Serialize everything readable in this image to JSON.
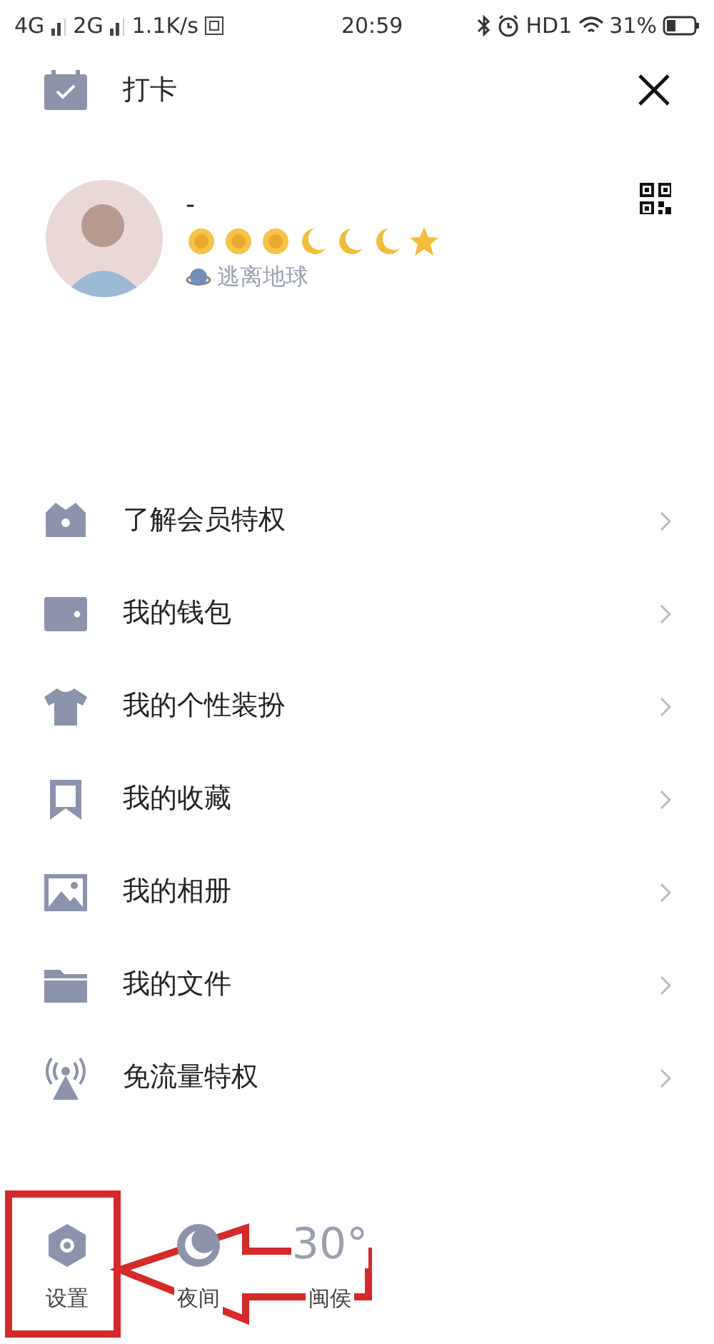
{
  "status_bar": {
    "network_1": "4G",
    "network_2": "2G",
    "speed": "1.1K/s",
    "time": "20:59",
    "hd": "HD1",
    "battery": "31%"
  },
  "header": {
    "title": "打卡"
  },
  "profile": {
    "name": "-",
    "level_icons": [
      {
        "kind": "sun"
      },
      {
        "kind": "sun"
      },
      {
        "kind": "sun"
      },
      {
        "kind": "moon"
      },
      {
        "kind": "moon"
      },
      {
        "kind": "moon"
      },
      {
        "kind": "star"
      }
    ],
    "location": "逃离地球"
  },
  "menu": [
    {
      "label": "了解会员特权"
    },
    {
      "label": "我的钱包"
    },
    {
      "label": "我的个性装扮"
    },
    {
      "label": "我的收藏"
    },
    {
      "label": "我的相册"
    },
    {
      "label": "我的文件"
    },
    {
      "label": "免流量特权"
    }
  ],
  "bottom_bar": [
    {
      "kind": "settings",
      "label": "设置"
    },
    {
      "kind": "night",
      "label": "夜间"
    },
    {
      "kind": "weather",
      "value": "30°",
      "label": "闽侯"
    }
  ]
}
